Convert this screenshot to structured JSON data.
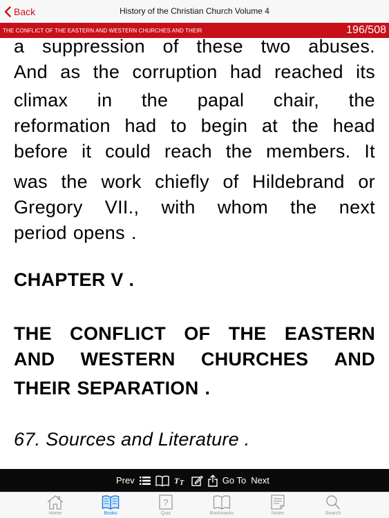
{
  "navbar": {
    "back_label": "Back",
    "title": "History of the Christian Church Volume 4"
  },
  "chapter_bar": {
    "title": "THE CONFLICT OF THE EASTERN AND WESTERN CHURCHES AND THEIR",
    "page_counter": "196/508"
  },
  "content": {
    "paragraph1": [
      "a suppression of these two abuses.",
      "And as the corruption had reached its"
    ],
    "paragraph2": [
      "climax in the papal chair, the",
      "reformation had to begin at the head",
      "before it could reach the members. It"
    ],
    "paragraph3": [
      "was the work chiefly of Hildebrand or",
      "Gregory VII., with whom the next",
      "period opens ."
    ],
    "chapter_heading": "CHAPTER V .",
    "chapter_title": [
      "THE CONFLICT OF THE EASTERN",
      "AND WESTERN CHURCHES AND",
      "THEIR SEPARATION ."
    ],
    "section_heading": "67. Sources and Literature ."
  },
  "toolbar": {
    "prev_label": "Prev",
    "goto_label": "Go To",
    "next_label": "Next"
  },
  "tabs": [
    {
      "label": "Home",
      "icon": "home-icon",
      "active": false
    },
    {
      "label": "Books",
      "icon": "books-icon",
      "active": true
    },
    {
      "label": "Quiz",
      "icon": "quiz-icon",
      "active": false
    },
    {
      "label": "Bookmarks",
      "icon": "bookmarks-icon",
      "active": false
    },
    {
      "label": "Notes",
      "icon": "notes-icon",
      "active": false
    },
    {
      "label": "Search",
      "icon": "search-icon",
      "active": false
    }
  ],
  "colors": {
    "accent_red": "#c8101a",
    "tab_active": "#1e7fe0",
    "tab_inactive": "#9b9b9b",
    "toolbar_bg": "#0a0a0a"
  }
}
